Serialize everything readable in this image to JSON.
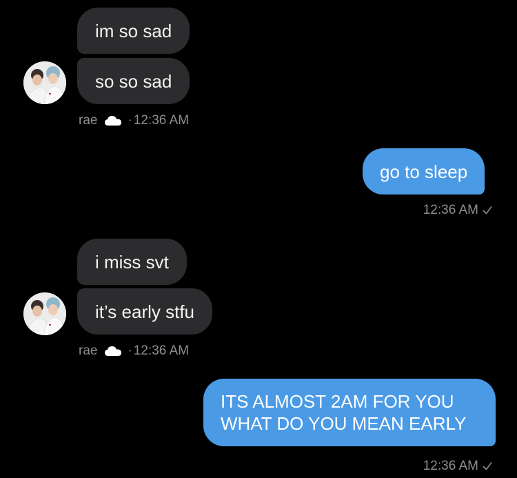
{
  "conversation": {
    "messages": [
      {
        "direction": "incoming",
        "text": "im so sad"
      },
      {
        "direction": "incoming",
        "text": "so so sad"
      },
      {
        "direction": "outgoing",
        "text": "go to sleep"
      },
      {
        "direction": "incoming",
        "text": "i miss svt"
      },
      {
        "direction": "incoming",
        "text": "it’s early stfu"
      },
      {
        "direction": "outgoing",
        "text": "ITS ALMOST 2AM FOR YOU WHAT DO YOU MEAN EARLY"
      }
    ],
    "groups": [
      {
        "sender": "rae",
        "dot": "·",
        "time": "12:36 AM",
        "status_icon": "cloud-icon"
      },
      {
        "time": "12:36 AM",
        "status_icon": "check-icon"
      },
      {
        "sender": "rae",
        "dot": "·",
        "time": "12:36 AM",
        "status_icon": "cloud-icon"
      },
      {
        "time": "12:36 AM",
        "status_icon": "check-icon"
      }
    ]
  },
  "colors": {
    "background": "#000000",
    "incoming_bubble": "#2c2c2e",
    "outgoing_bubble": "#4b9ae6",
    "meta_text": "#8e8e93"
  }
}
